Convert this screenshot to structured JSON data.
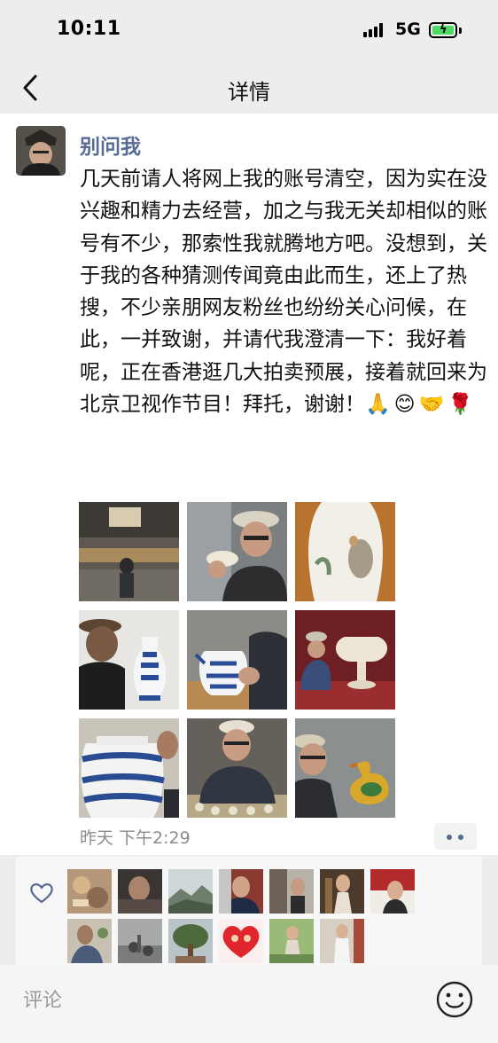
{
  "status_bar": {
    "time": "10:11",
    "network": "5G"
  },
  "nav": {
    "title": "详情"
  },
  "post": {
    "username": "别问我",
    "text": "几天前请人将网上我的账号清空，因为实在没兴趣和精力去经营，加之与我无关却相似的账号有不少，那索性我就腾地方吧。没想到，关于我的各种猜测传闻竟由此而生，还上了热搜，不少亲朋网友粉丝也纷纷关心问候，在此，一并致谢，并请代我澄清一下：我好着呢，正在香港逛几大拍卖预展，接着就回来为北京卫视作节目！拜托，谢谢！",
    "emojis": "🙏😊🤝🌹",
    "time": "昨天 下午2:29",
    "photo_count": 9
  },
  "likes": {
    "count": 13
  },
  "comment": {
    "placeholder": "评论"
  },
  "colors": {
    "accent": "#576b95",
    "background": "#ededed"
  },
  "icons": [
    "back-chevron-icon",
    "heart-icon",
    "emoji-face-icon",
    "more-dots-icon"
  ]
}
